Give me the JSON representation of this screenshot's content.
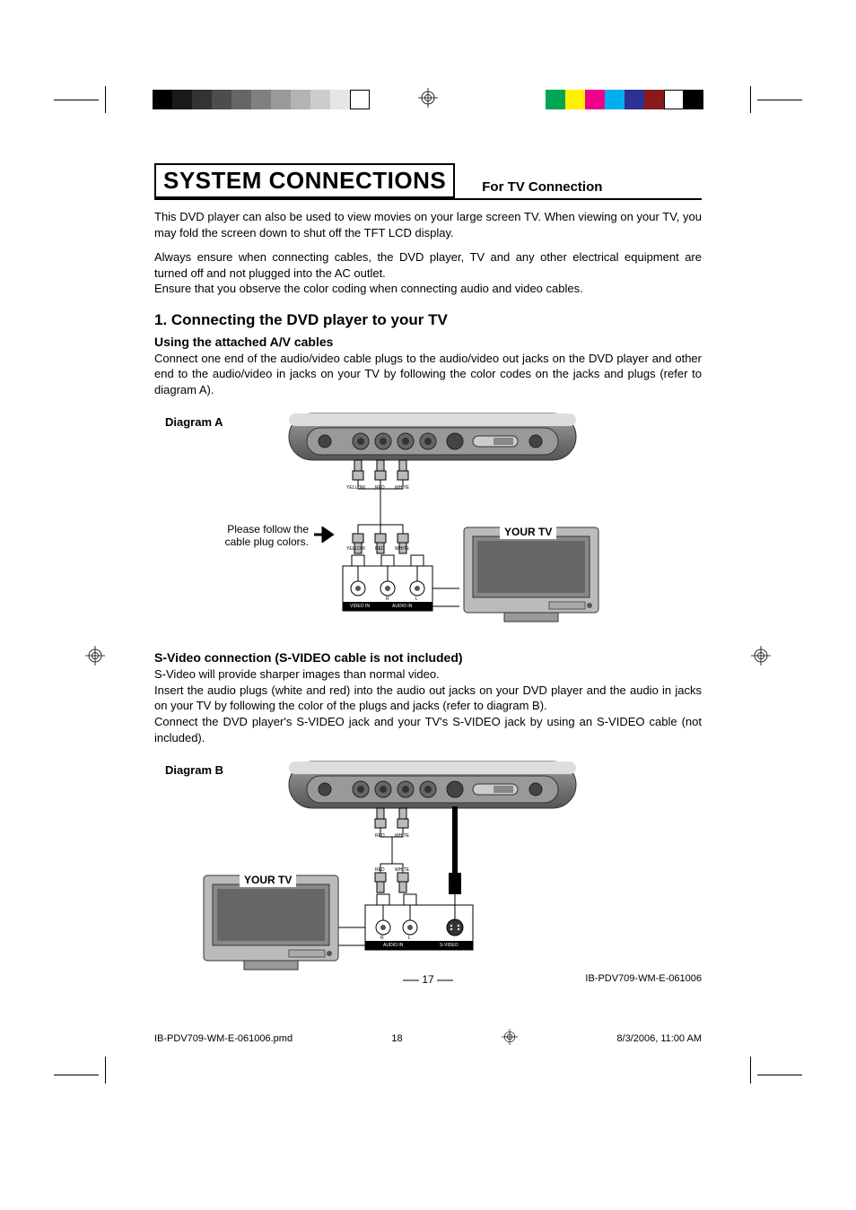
{
  "header": {
    "title": "SYSTEM CONNECTIONS",
    "subtitle": "For TV Connection"
  },
  "intro": {
    "p1": "This DVD player can also be used to view movies on your large screen TV. When viewing on your TV, you may fold the screen down to shut off the TFT LCD display.",
    "p2": "Always ensure when connecting cables, the DVD player, TV and any other electrical equipment are turned off and not plugged into the AC outlet.",
    "p3": "Ensure that you observe the color coding when connecting audio and video cables."
  },
  "section1": {
    "heading": "1. Connecting the DVD player to your TV",
    "sub1_heading": "Using the attached A/V cables",
    "sub1_text": "Connect one end of the audio/video cable plugs to the audio/video out jacks on the DVD player and other end to the audio/video in jacks on your TV by following the color codes on the jacks and plugs (refer to diagram A).",
    "diagramA": {
      "label": "Diagram A",
      "follow_text_l1": "Please follow the",
      "follow_text_l2": "cable plug colors.",
      "tv_label": "YOUR TV",
      "plugs": {
        "yellow": "YELLOW",
        "red": "RED",
        "white": "WHITE"
      },
      "tv_jacks": {
        "video_in": "VIDEO IN",
        "audio_in": "AUDIO IN",
        "r": "R",
        "l": "L"
      }
    },
    "sub2_heading": "S-Video connection (S-VIDEO cable is not included)",
    "sub2_p1": "S-Video will provide sharper images than normal video.",
    "sub2_p2": "Insert the audio plugs (white and red) into the audio out jacks on your DVD player and the audio in jacks on your TV by following the color of the plugs and jacks (refer to diagram B).",
    "sub2_p3": "Connect the DVD player's S-VIDEO jack and your TV's S-VIDEO jack by using an S-VIDEO cable (not included).",
    "diagramB": {
      "label": "Diagram B",
      "tv_label": "YOUR TV",
      "plugs": {
        "red": "RED",
        "white": "WHITE"
      },
      "tv_jacks": {
        "audio_in": "AUDIO IN",
        "svideo": "S-VIDEO",
        "r": "R",
        "l": "L"
      }
    }
  },
  "footer": {
    "page_num": "17",
    "doc_id": "IB-PDV709-WM-E-061006",
    "file": "IB-PDV709-WM-E-061006.pmd",
    "sheet": "18",
    "date": "8/3/2006, 11:00 AM"
  },
  "print": {
    "grayscale": [
      "#000000",
      "#1a1a1a",
      "#333333",
      "#4d4d4d",
      "#666666",
      "#808080",
      "#999999",
      "#b3b3b3",
      "#cccccc",
      "#e6e6e6",
      "#ffffff"
    ],
    "colors": [
      "#00a651",
      "#fff200",
      "#ec008c",
      "#00aeef",
      "#2e3192",
      "#ed1c24",
      "#ffffff",
      "#000000"
    ]
  }
}
